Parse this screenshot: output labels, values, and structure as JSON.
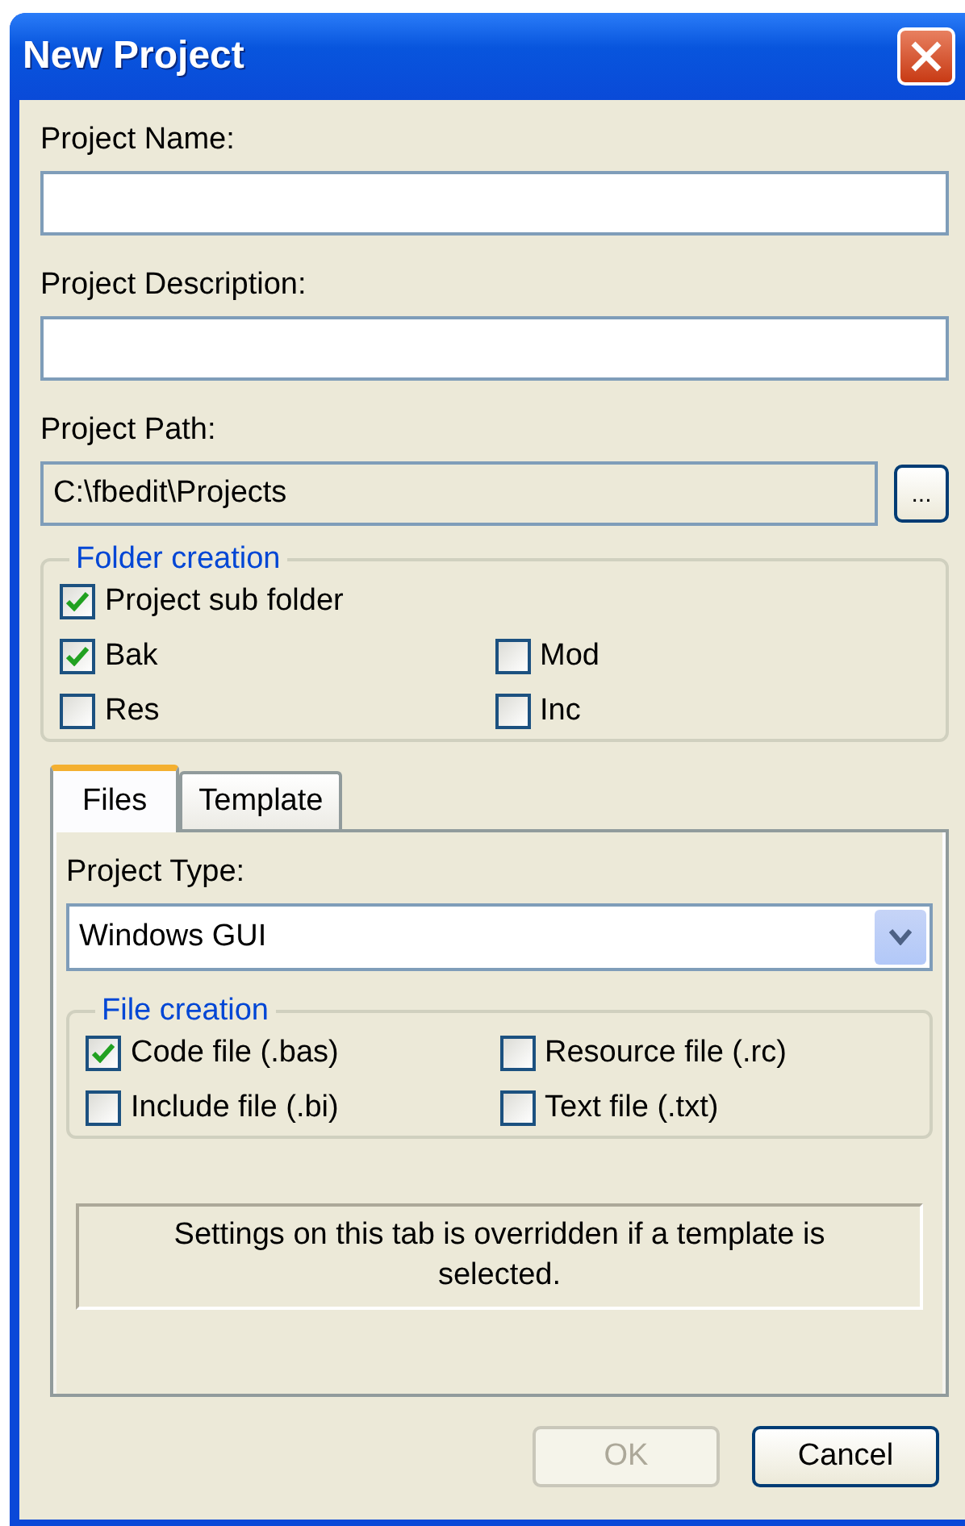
{
  "window": {
    "title": "New Project"
  },
  "fields": [
    {
      "label": "Project Name:",
      "readonly": false
    },
    {
      "label": "Project Description:",
      "readonly": false
    },
    {
      "label": "Project Path:",
      "value": "C:\\fbedit\\Projects",
      "readonly": true
    }
  ],
  "browse_button": "...",
  "folder_creation": {
    "title": "Folder creation",
    "options": [
      {
        "label": "Project sub folder",
        "checked": true
      },
      {
        "label": "Bak",
        "checked": true
      },
      {
        "label": "Mod",
        "checked": false
      },
      {
        "label": "Res",
        "checked": false
      },
      {
        "label": "Inc",
        "checked": false
      }
    ]
  },
  "tabs": [
    {
      "label": "Files",
      "selected": true
    },
    {
      "label": "Template",
      "selected": false
    }
  ],
  "project_type": {
    "label": "Project Type:",
    "value": "Windows GUI"
  },
  "file_creation": {
    "title": "File creation",
    "options": [
      {
        "label": "Code file (.bas)",
        "checked": true
      },
      {
        "label": "Resource file (.rc)",
        "checked": false
      },
      {
        "label": "Include file (.bi)",
        "checked": false
      },
      {
        "label": "Text file (.txt)",
        "checked": false
      }
    ]
  },
  "note": "Settings on this tab is overridden if a template is selected.",
  "buttons": [
    {
      "label": "OK",
      "disabled": true
    },
    {
      "label": "Cancel",
      "disabled": false
    }
  ]
}
